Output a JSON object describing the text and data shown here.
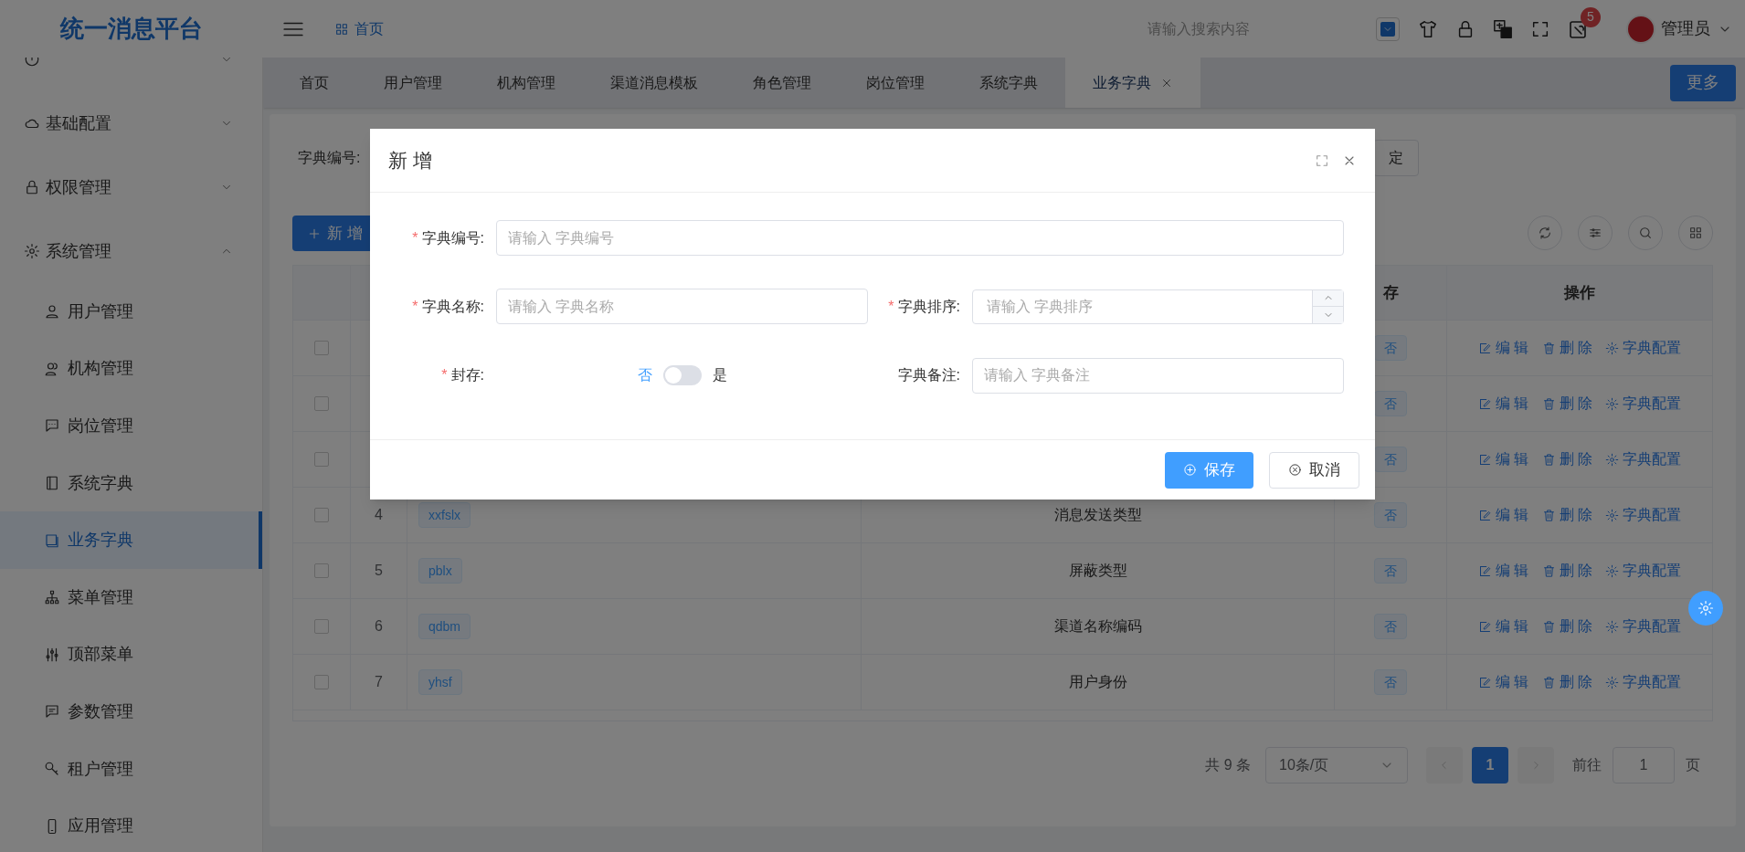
{
  "header": {
    "title": "统一消息平台",
    "breadcrumb": "首页",
    "search": {
      "placeholder": "请输入搜索内容"
    },
    "notification_count": "5",
    "user": "管理员"
  },
  "sidebar": {
    "items": [
      {
        "expanded": false
      },
      {
        "label": "基础配置",
        "expanded": false
      },
      {
        "label": "权限管理",
        "expanded": false
      },
      {
        "label": "系统管理",
        "expanded": true,
        "children": [
          {
            "label": "用户管理",
            "selected": false
          },
          {
            "label": "机构管理",
            "selected": false
          },
          {
            "label": "岗位管理",
            "selected": false
          },
          {
            "label": "系统字典",
            "selected": false
          },
          {
            "label": "业务字典",
            "selected": true
          },
          {
            "label": "菜单管理",
            "selected": false
          },
          {
            "label": "顶部菜单",
            "selected": false
          },
          {
            "label": "参数管理",
            "selected": false
          },
          {
            "label": "租户管理",
            "selected": false
          },
          {
            "label": "应用管理",
            "selected": false
          }
        ]
      }
    ]
  },
  "tabs": [
    {
      "label": "首页",
      "selected": false,
      "closable": false
    },
    {
      "label": "用户管理",
      "selected": false,
      "closable": false
    },
    {
      "label": "机构管理",
      "selected": false,
      "closable": false
    },
    {
      "label": "渠道消息模板",
      "selected": false,
      "closable": false
    },
    {
      "label": "角色管理",
      "selected": false,
      "closable": false
    },
    {
      "label": "岗位管理",
      "selected": false,
      "closable": false
    },
    {
      "label": "系统字典",
      "selected": false,
      "closable": false
    },
    {
      "label": "业务字典",
      "selected": true,
      "closable": true
    }
  ],
  "more_button": "更多",
  "filter": {
    "label": "字典编号:",
    "button": "定"
  },
  "add_button": "新 增",
  "table": {
    "sealed_column": "存",
    "actions_column": "操作",
    "rows": [
      {
        "checked": false,
        "sealed": "否",
        "actions": [
          "编 辑",
          "删 除",
          "字典配置"
        ]
      },
      {
        "checked": false,
        "sealed": "否",
        "actions": [
          "编 辑",
          "删 除",
          "字典配置"
        ]
      },
      {
        "checked": false,
        "sealed": "否",
        "actions": [
          "编 辑",
          "删 除",
          "字典配置"
        ]
      },
      {
        "checked": false,
        "index": "4",
        "code": "xxfslx",
        "name": "消息发送类型",
        "sealed": "否",
        "actions": [
          "编 辑",
          "删 除",
          "字典配置"
        ]
      },
      {
        "checked": false,
        "index": "5",
        "code": "pblx",
        "name": "屏蔽类型",
        "sealed": "否",
        "actions": [
          "编 辑",
          "删 除",
          "字典配置"
        ]
      },
      {
        "checked": false,
        "index": "6",
        "code": "qdbm",
        "name": "渠道名称编码",
        "sealed": "否",
        "actions": [
          "编 辑",
          "删 除",
          "字典配置"
        ]
      },
      {
        "checked": false,
        "index": "7",
        "code": "yhsf",
        "name": "用户身份",
        "sealed": "否",
        "actions": [
          "编 辑",
          "删 除",
          "字典配置"
        ]
      }
    ]
  },
  "pagination": {
    "total": "共 9 条",
    "page_size": "10条/页",
    "pages": [
      {
        "label": "1",
        "selected": true
      }
    ],
    "goto_label": "前往",
    "goto_value": "1",
    "page_suffix": "页"
  },
  "modal": {
    "title": "新 增",
    "rows": [
      [
        {
          "kind": "text",
          "label": "字典编号:",
          "required_mark": "*",
          "placeholder": "请输入 字典编号"
        }
      ],
      [
        {
          "kind": "text",
          "label": "字典名称:",
          "required_mark": "*",
          "placeholder": "请输入 字典名称"
        },
        {
          "kind": "number",
          "label": "字典排序:",
          "required_mark": "*",
          "placeholder": "请输入 字典排序"
        }
      ],
      [
        {
          "kind": "switch",
          "label": "封存:",
          "required_mark": "*",
          "off_label": "否",
          "on_label": "是",
          "on": false
        },
        {
          "kind": "text",
          "label": "字典备注:",
          "placeholder": "请输入 字典备注"
        }
      ]
    ],
    "buttons": [
      {
        "kind": "primary",
        "label": "保存"
      },
      {
        "kind": "default",
        "label": "取消"
      }
    ]
  }
}
